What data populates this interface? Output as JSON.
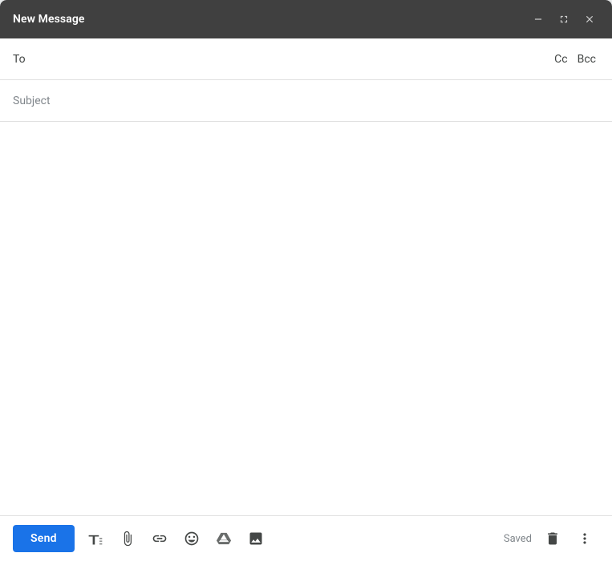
{
  "header": {
    "title": "New Message",
    "minimize_label": "Minimize",
    "expand_label": "Expand",
    "close_label": "Close"
  },
  "fields": {
    "to_label": "To",
    "to_placeholder": "",
    "cc_label": "Cc",
    "bcc_label": "Bcc",
    "subject_label": "Subject",
    "subject_placeholder": "Subject"
  },
  "footer": {
    "send_label": "Send",
    "saved_text": "Saved"
  },
  "toolbar": {
    "formatting_icon": "format-text-icon",
    "attach_icon": "attach-icon",
    "link_icon": "link-icon",
    "emoji_icon": "emoji-icon",
    "drive_icon": "drive-icon",
    "photo_icon": "photo-icon",
    "delete_icon": "delete-icon",
    "more_icon": "more-options-icon"
  }
}
